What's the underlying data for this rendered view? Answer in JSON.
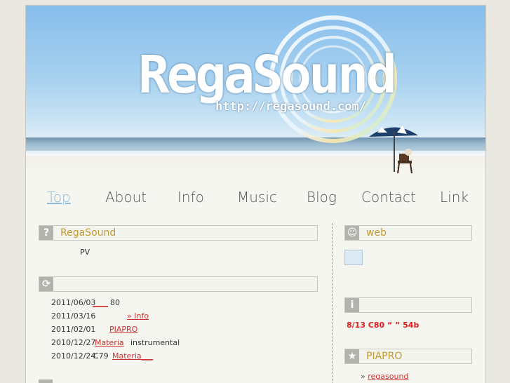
{
  "site": {
    "logo_text": "RegaSound",
    "logo_url_text": "http://regasound.com/"
  },
  "nav": {
    "items": [
      {
        "label": "Top",
        "active": true
      },
      {
        "label": "About"
      },
      {
        "label": "Info"
      },
      {
        "label": "Music"
      },
      {
        "label": "Blog"
      },
      {
        "label": "Contact"
      },
      {
        "label": "Link"
      }
    ]
  },
  "main": {
    "intro": {
      "icon": "?",
      "icon_name": "question-icon",
      "title": "RegaSound",
      "text": "PV"
    },
    "updates": {
      "icon_name": "refresh-icon",
      "title": "",
      "rows": [
        {
          "date": "2011/06/03",
          "link": "____",
          "after": "80"
        },
        {
          "date": "2011/03/16",
          "link": "» Info",
          "after": ""
        },
        {
          "date": "2011/02/01",
          "link": "PIAPRO",
          "after": ""
        },
        {
          "date": "2010/12/27",
          "link": "Materia",
          "after": "instrumental"
        },
        {
          "date": "2010/12/24",
          "pre": "C79",
          "link": "Materia___",
          "after": ""
        }
      ]
    }
  },
  "sidebar": {
    "web": {
      "icon_name": "smile-icon",
      "title": "web"
    },
    "info": {
      "icon": "i",
      "icon_name": "info-icon",
      "title": "",
      "alert": "8/13  C80      “  ” 54b"
    },
    "piapro": {
      "icon": "★",
      "icon_name": "star-icon",
      "title": "PIAPRO",
      "link_prefix": "»",
      "link": "regasound"
    }
  },
  "colors": {
    "accent_title": "#bf9a32",
    "link": "#cc3333",
    "alert": "#e21b1b",
    "nav_active": "#8bb9dc"
  }
}
